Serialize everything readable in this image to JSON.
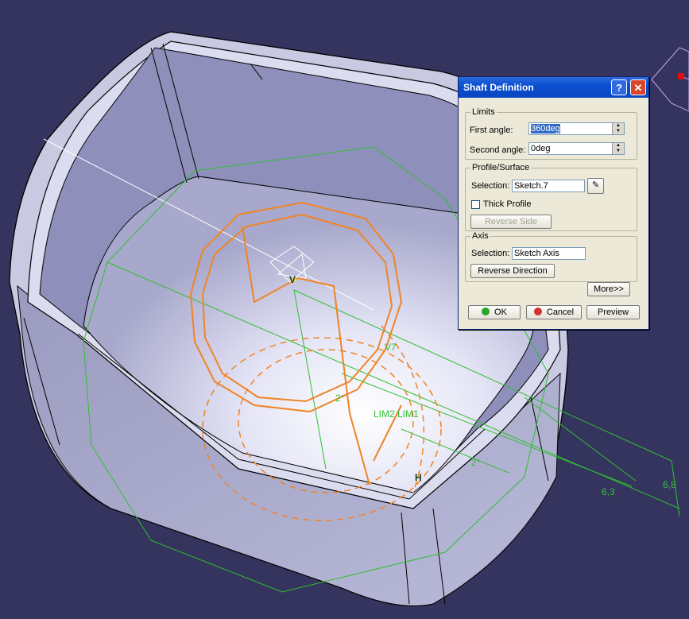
{
  "viewport": {
    "background": "#34345e",
    "annotations": [
      {
        "name": "dimension-label-2deg-top",
        "text": "2°"
      },
      {
        "name": "dimension-label-2deg-bottom",
        "text": "2°"
      },
      {
        "name": "constraint-label-lim",
        "text": "LIM2 LIM1"
      },
      {
        "name": "dimension-label-6-3",
        "text": "6,3"
      },
      {
        "name": "dimension-label-6-8",
        "text": "6,8"
      },
      {
        "name": "constraint-label-v7",
        "text": "V7"
      },
      {
        "name": "constraint-label-v",
        "text": "V"
      },
      {
        "name": "constraint-label-h",
        "text": "H"
      }
    ]
  },
  "dialog": {
    "title": "Shaft Definition",
    "help_glyph": "?",
    "close_glyph": "✕",
    "limits": {
      "legend": "Limits",
      "first_angle_label": "First angle:",
      "first_angle_value": "360deg",
      "second_angle_label": "Second angle:",
      "second_angle_value": "0deg"
    },
    "profile": {
      "legend": "Profile/Surface",
      "selection_label": "Selection:",
      "selection_value": "Sketch.7",
      "thick_profile_label": "Thick Profile",
      "thick_profile_checked": false,
      "reverse_side_label": "Reverse Side"
    },
    "axis": {
      "legend": "Axis",
      "selection_label": "Selection:",
      "selection_value": "Sketch Axis",
      "reverse_direction_label": "Reverse Direction"
    },
    "more_label": "More>>",
    "ok_label": "OK",
    "cancel_label": "Cancel",
    "preview_label": "Preview",
    "colors": {
      "ok_dot": "#2aa52a",
      "cancel_dot": "#d2322d",
      "title_bar": "#0a4fd1"
    }
  }
}
